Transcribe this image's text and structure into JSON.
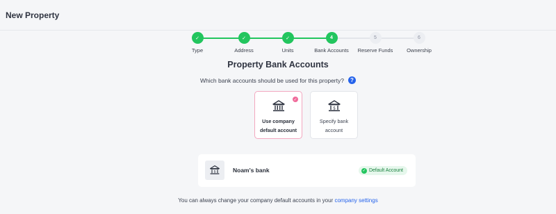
{
  "header": {
    "title": "New Property"
  },
  "colors": {
    "accent_green": "#22c55e",
    "link_blue": "#2563eb",
    "selected_pink": "#f06a9a"
  },
  "stepper": {
    "steps": [
      {
        "label": "Type",
        "state": "done",
        "marker": "✓"
      },
      {
        "label": "Address",
        "state": "done",
        "marker": "✓"
      },
      {
        "label": "Units",
        "state": "done",
        "marker": "✓"
      },
      {
        "label": "Bank Accounts",
        "state": "current",
        "marker": "4"
      },
      {
        "label": "Reserve Funds",
        "state": "pending",
        "marker": "5"
      },
      {
        "label": "Ownership",
        "state": "pending",
        "marker": "6"
      }
    ]
  },
  "main": {
    "title": "Property Bank Accounts",
    "question": "Which bank accounts should be used for this property?",
    "help_icon": "?",
    "options": [
      {
        "label": "Use company default account",
        "icon": "bank-icon",
        "selected": true
      },
      {
        "label": "Specify bank account",
        "icon": "bank-dollar-icon",
        "selected": false
      }
    ],
    "bank": {
      "name": "Noam's bank",
      "badge": "Default Account"
    },
    "footer_text": "You can always change your company default accounts in your",
    "footer_link": "company settings"
  }
}
